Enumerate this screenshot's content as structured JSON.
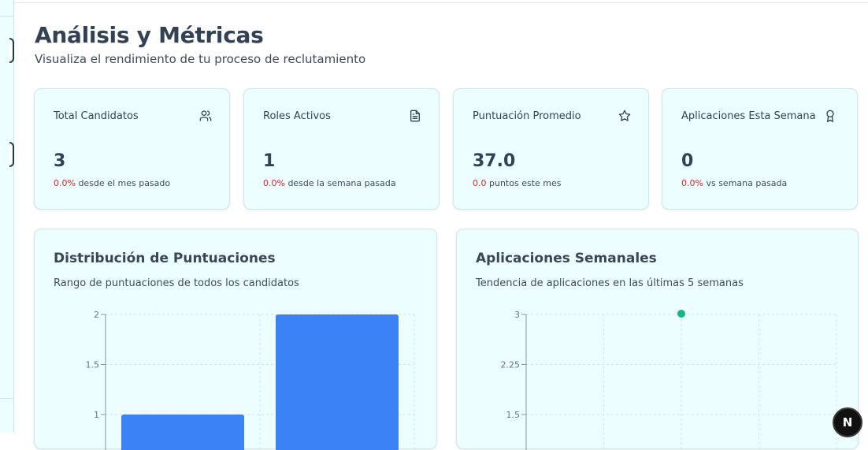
{
  "header": {
    "title": "Análisis y Métricas",
    "subtitle": "Visualiza el rendimiento de tu proceso de reclutamiento"
  },
  "stats": [
    {
      "title": "Total Candidatos",
      "icon": "users-icon",
      "value": "3",
      "change": "0.0%",
      "change_text": "desde el mes pasado"
    },
    {
      "title": "Roles Activos",
      "icon": "document-icon",
      "value": "1",
      "change": "0.0%",
      "change_text": "desde la semana pasada"
    },
    {
      "title": "Puntuación Promedio",
      "icon": "star-icon",
      "value": "37.0",
      "change": "0.0",
      "change_text": "puntos este mes"
    },
    {
      "title": "Aplicaciones Esta Semana",
      "icon": "award-icon",
      "value": "0",
      "change": "0.0%",
      "change_text": "vs semana pasada"
    }
  ],
  "charts": {
    "distribution": {
      "title": "Distribución de Puntuaciones",
      "subtitle": "Rango de puntuaciones de todos los candidatos"
    },
    "weekly": {
      "title": "Aplicaciones Semanales",
      "subtitle": "Tendencia de aplicaciones en las últimas 5 semanas"
    }
  },
  "chart_data": [
    {
      "type": "bar",
      "ylim": [
        0,
        2
      ],
      "yticks": [
        "2",
        "1.5",
        "1"
      ],
      "values": [
        1,
        2
      ],
      "color": "#3b82f6"
    },
    {
      "type": "line",
      "ylim": [
        0,
        3
      ],
      "yticks": [
        "3",
        "2.25",
        "1.5"
      ],
      "points": [
        {
          "x_index": 2,
          "y": 3
        }
      ],
      "color": "#10b981"
    }
  ],
  "badge": {
    "label": "N"
  },
  "colors": {
    "accent_negative": "#dc2626",
    "card_bg": "#ecfeff",
    "bar": "#3b82f6",
    "line": "#10b981"
  }
}
